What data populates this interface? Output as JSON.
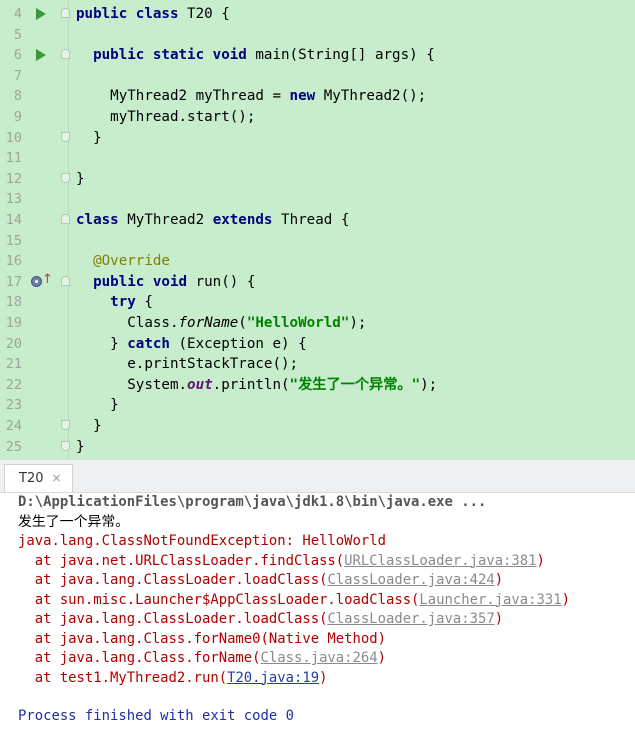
{
  "editor": {
    "lines": [
      {
        "num": "4",
        "html": "<span class=\"kw\">public class</span> T20 {"
      },
      {
        "num": "5",
        "html": ""
      },
      {
        "num": "6",
        "html": "  <span class=\"kw\">public static void</span> main(String[] args) {"
      },
      {
        "num": "7",
        "html": ""
      },
      {
        "num": "8",
        "html": "    MyThread2 myThread = <span class=\"kw\">new</span> MyThread2();"
      },
      {
        "num": "9",
        "html": "    myThread.start();"
      },
      {
        "num": "10",
        "html": "  }"
      },
      {
        "num": "11",
        "html": ""
      },
      {
        "num": "12",
        "html": "}"
      },
      {
        "num": "13",
        "html": ""
      },
      {
        "num": "14",
        "html": "<span class=\"kw\">class</span> MyThread2 <span class=\"kw\">extends</span> Thread {"
      },
      {
        "num": "15",
        "html": ""
      },
      {
        "num": "16",
        "html": "  <span class=\"ann\">@Override</span>"
      },
      {
        "num": "17",
        "html": "  <span class=\"kw\">public void</span> run() {"
      },
      {
        "num": "18",
        "html": "    <span class=\"kw\">try</span> {"
      },
      {
        "num": "19",
        "html": "      Class.<span class=\"ital\">forName</span>(<span class=\"str\">\"HelloWorld\"</span>);"
      },
      {
        "num": "20",
        "html": "    } <span class=\"kw\">catch</span> (Exception e) {"
      },
      {
        "num": "21",
        "html": "      e.printStackTrace();"
      },
      {
        "num": "22",
        "html": "      System.<span class=\"fld\">out</span>.println(<span class=\"str\">\"发生了一个异常。\"</span>);"
      },
      {
        "num": "23",
        "html": "    }"
      },
      {
        "num": "24",
        "html": "  }"
      },
      {
        "num": "25",
        "html": "}"
      }
    ]
  },
  "run_tab": {
    "label": "T20",
    "close": "×"
  },
  "console": {
    "command": "D:\\ApplicationFiles\\program\\java\\jdk1.8\\bin\\java.exe ...",
    "stdout": "发生了一个异常。",
    "exception": "java.lang.ClassNotFoundException: HelloWorld",
    "stack": [
      {
        "prefix": "  at java.net.URLClassLoader.findClass(",
        "link": "URLClassLoader.java:381",
        "suffix": ")",
        "dark": false
      },
      {
        "prefix": "  at java.lang.ClassLoader.loadClass(",
        "link": "ClassLoader.java:424",
        "suffix": ")",
        "dark": false
      },
      {
        "prefix": "  at sun.misc.Launcher$AppClassLoader.loadClass(",
        "link": "Launcher.java:331",
        "suffix": ")",
        "dark": false
      },
      {
        "prefix": "  at java.lang.ClassLoader.loadClass(",
        "link": "ClassLoader.java:357",
        "suffix": ")",
        "dark": false
      },
      {
        "prefix": "  at java.lang.Class.forName0(Native Method)",
        "link": "",
        "suffix": "",
        "dark": false
      },
      {
        "prefix": "  at java.lang.Class.forName(",
        "link": "Class.java:264",
        "suffix": ")",
        "dark": false
      },
      {
        "prefix": "  at test1.MyThread2.run(",
        "link": "T20.java:19",
        "suffix": ")",
        "dark": true
      }
    ],
    "exit": "Process finished with exit code 0"
  }
}
